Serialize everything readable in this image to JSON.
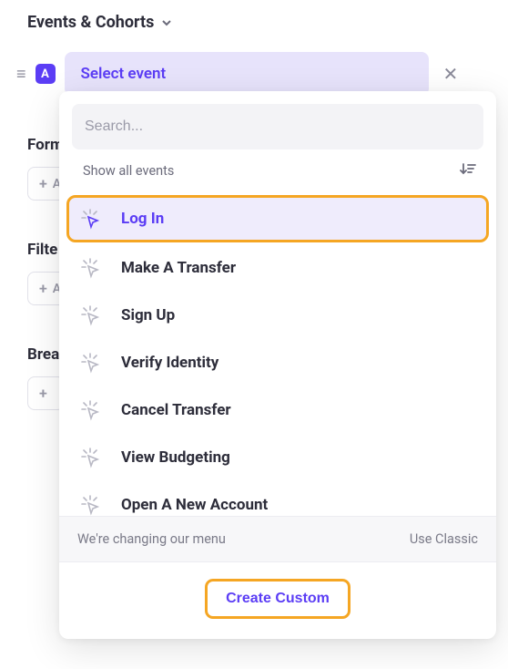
{
  "header": {
    "title": "Events & Cohorts"
  },
  "chip": {
    "letter": "A",
    "select_label": "Select event"
  },
  "bg_sections": [
    {
      "label": "Form",
      "add": "A"
    },
    {
      "label": "Filte",
      "add": "A"
    },
    {
      "label": "Brea",
      "add": ""
    }
  ],
  "dropdown": {
    "search_placeholder": "Search...",
    "show_prefix": "Show",
    "show_suffix": "all events",
    "events": [
      {
        "label": "Log In",
        "selected": true
      },
      {
        "label": "Make A Transfer",
        "selected": false
      },
      {
        "label": "Sign Up",
        "selected": false
      },
      {
        "label": "Verify Identity",
        "selected": false
      },
      {
        "label": "Cancel Transfer",
        "selected": false
      },
      {
        "label": "View Budgeting",
        "selected": false
      },
      {
        "label": "Open A New Account",
        "selected": false
      }
    ],
    "notice_text": "We're changing our menu",
    "use_classic": "Use Classic",
    "create_custom": "Create Custom"
  },
  "colors": {
    "accent": "#5b3df5",
    "highlight_border": "#f5a623",
    "muted": "#9a9aa8"
  }
}
